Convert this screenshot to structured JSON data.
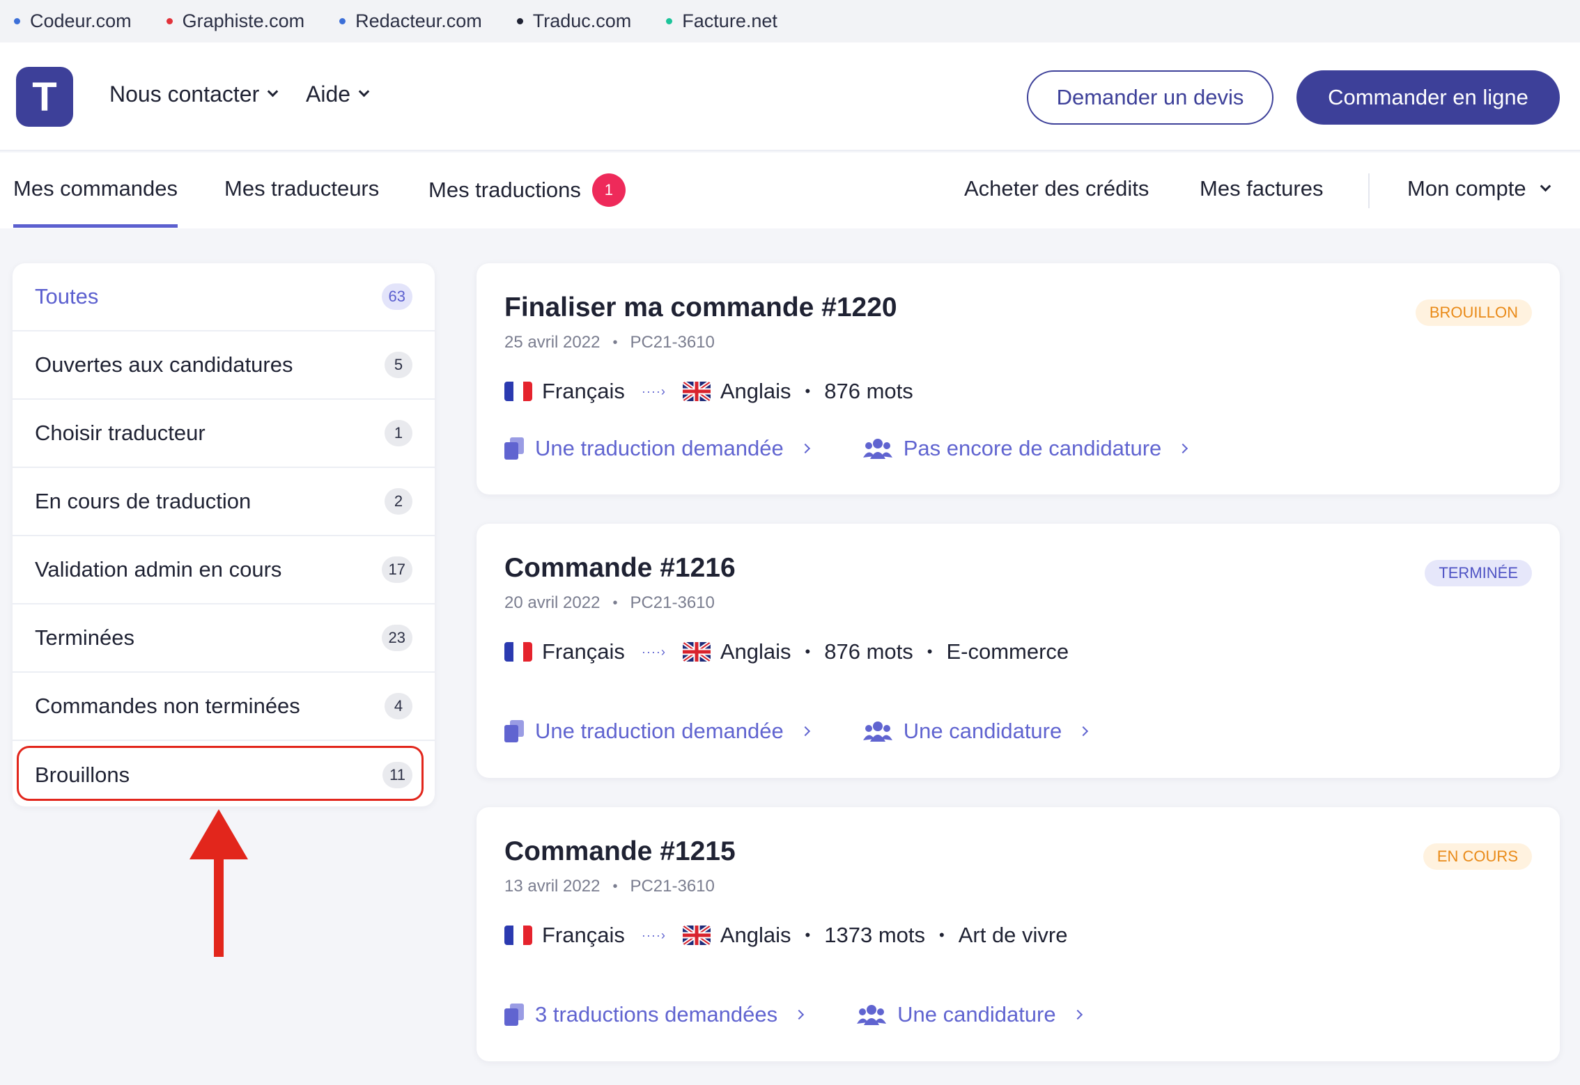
{
  "network": [
    {
      "label": "Codeur.com",
      "color": "#3c6fd8"
    },
    {
      "label": "Graphiste.com",
      "color": "#e2323a"
    },
    {
      "label": "Redacteur.com",
      "color": "#3c6fd8"
    },
    {
      "label": "Traduc.com",
      "color": "#1f2233"
    },
    {
      "label": "Facture.net",
      "color": "#1cc49a"
    }
  ],
  "header": {
    "logo_letter": "T",
    "menu": [
      "Nous contacter",
      "Aide"
    ],
    "quote_button": "Demander un devis",
    "order_button": "Commander en ligne"
  },
  "tabs": {
    "orders": "Mes commandes",
    "translators": "Mes traducteurs",
    "translations": "Mes traductions",
    "translations_badge": "1",
    "credits": "Acheter des crédits",
    "invoices": "Mes factures",
    "account": "Mon compte"
  },
  "sidebar": [
    {
      "label": "Toutes",
      "count": "63"
    },
    {
      "label": "Ouvertes aux candidatures",
      "count": "5"
    },
    {
      "label": "Choisir traducteur",
      "count": "1"
    },
    {
      "label": "En cours de traduction",
      "count": "2"
    },
    {
      "label": "Validation admin en cours",
      "count": "17"
    },
    {
      "label": "Terminées",
      "count": "23"
    },
    {
      "label": "Commandes non terminées",
      "count": "4"
    },
    {
      "label": "Brouillons",
      "count": "11"
    }
  ],
  "orders": [
    {
      "title": "Finaliser ma commande #1220",
      "date": "25 avril 2022",
      "ref": "PC21-3610",
      "status": "BROUILLON",
      "from": "Français",
      "to": "Anglais",
      "words": "876 mots",
      "category": "",
      "link1": "Une traduction demandée",
      "link2": "Pas encore de candidature"
    },
    {
      "title": "Commande #1216",
      "date": "20 avril 2022",
      "ref": "PC21-3610",
      "status": "TERMINÉE",
      "from": "Français",
      "to": "Anglais",
      "words": "876 mots",
      "category": "E-commerce",
      "link1": "Une traduction demandée",
      "link2": "Une candidature"
    },
    {
      "title": "Commande #1215",
      "date": "13 avril 2022",
      "ref": "PC21-3610",
      "status": "EN COURS",
      "from": "Français",
      "to": "Anglais",
      "words": "1373 mots",
      "category": "Art de vivre",
      "link1": "3 traductions demandées",
      "link2": "Une candidature"
    }
  ],
  "colors": {
    "brand": "#3d4099",
    "accent": "#5b5fcf",
    "alert": "#e2261c",
    "badge": "#ee2a5a"
  }
}
